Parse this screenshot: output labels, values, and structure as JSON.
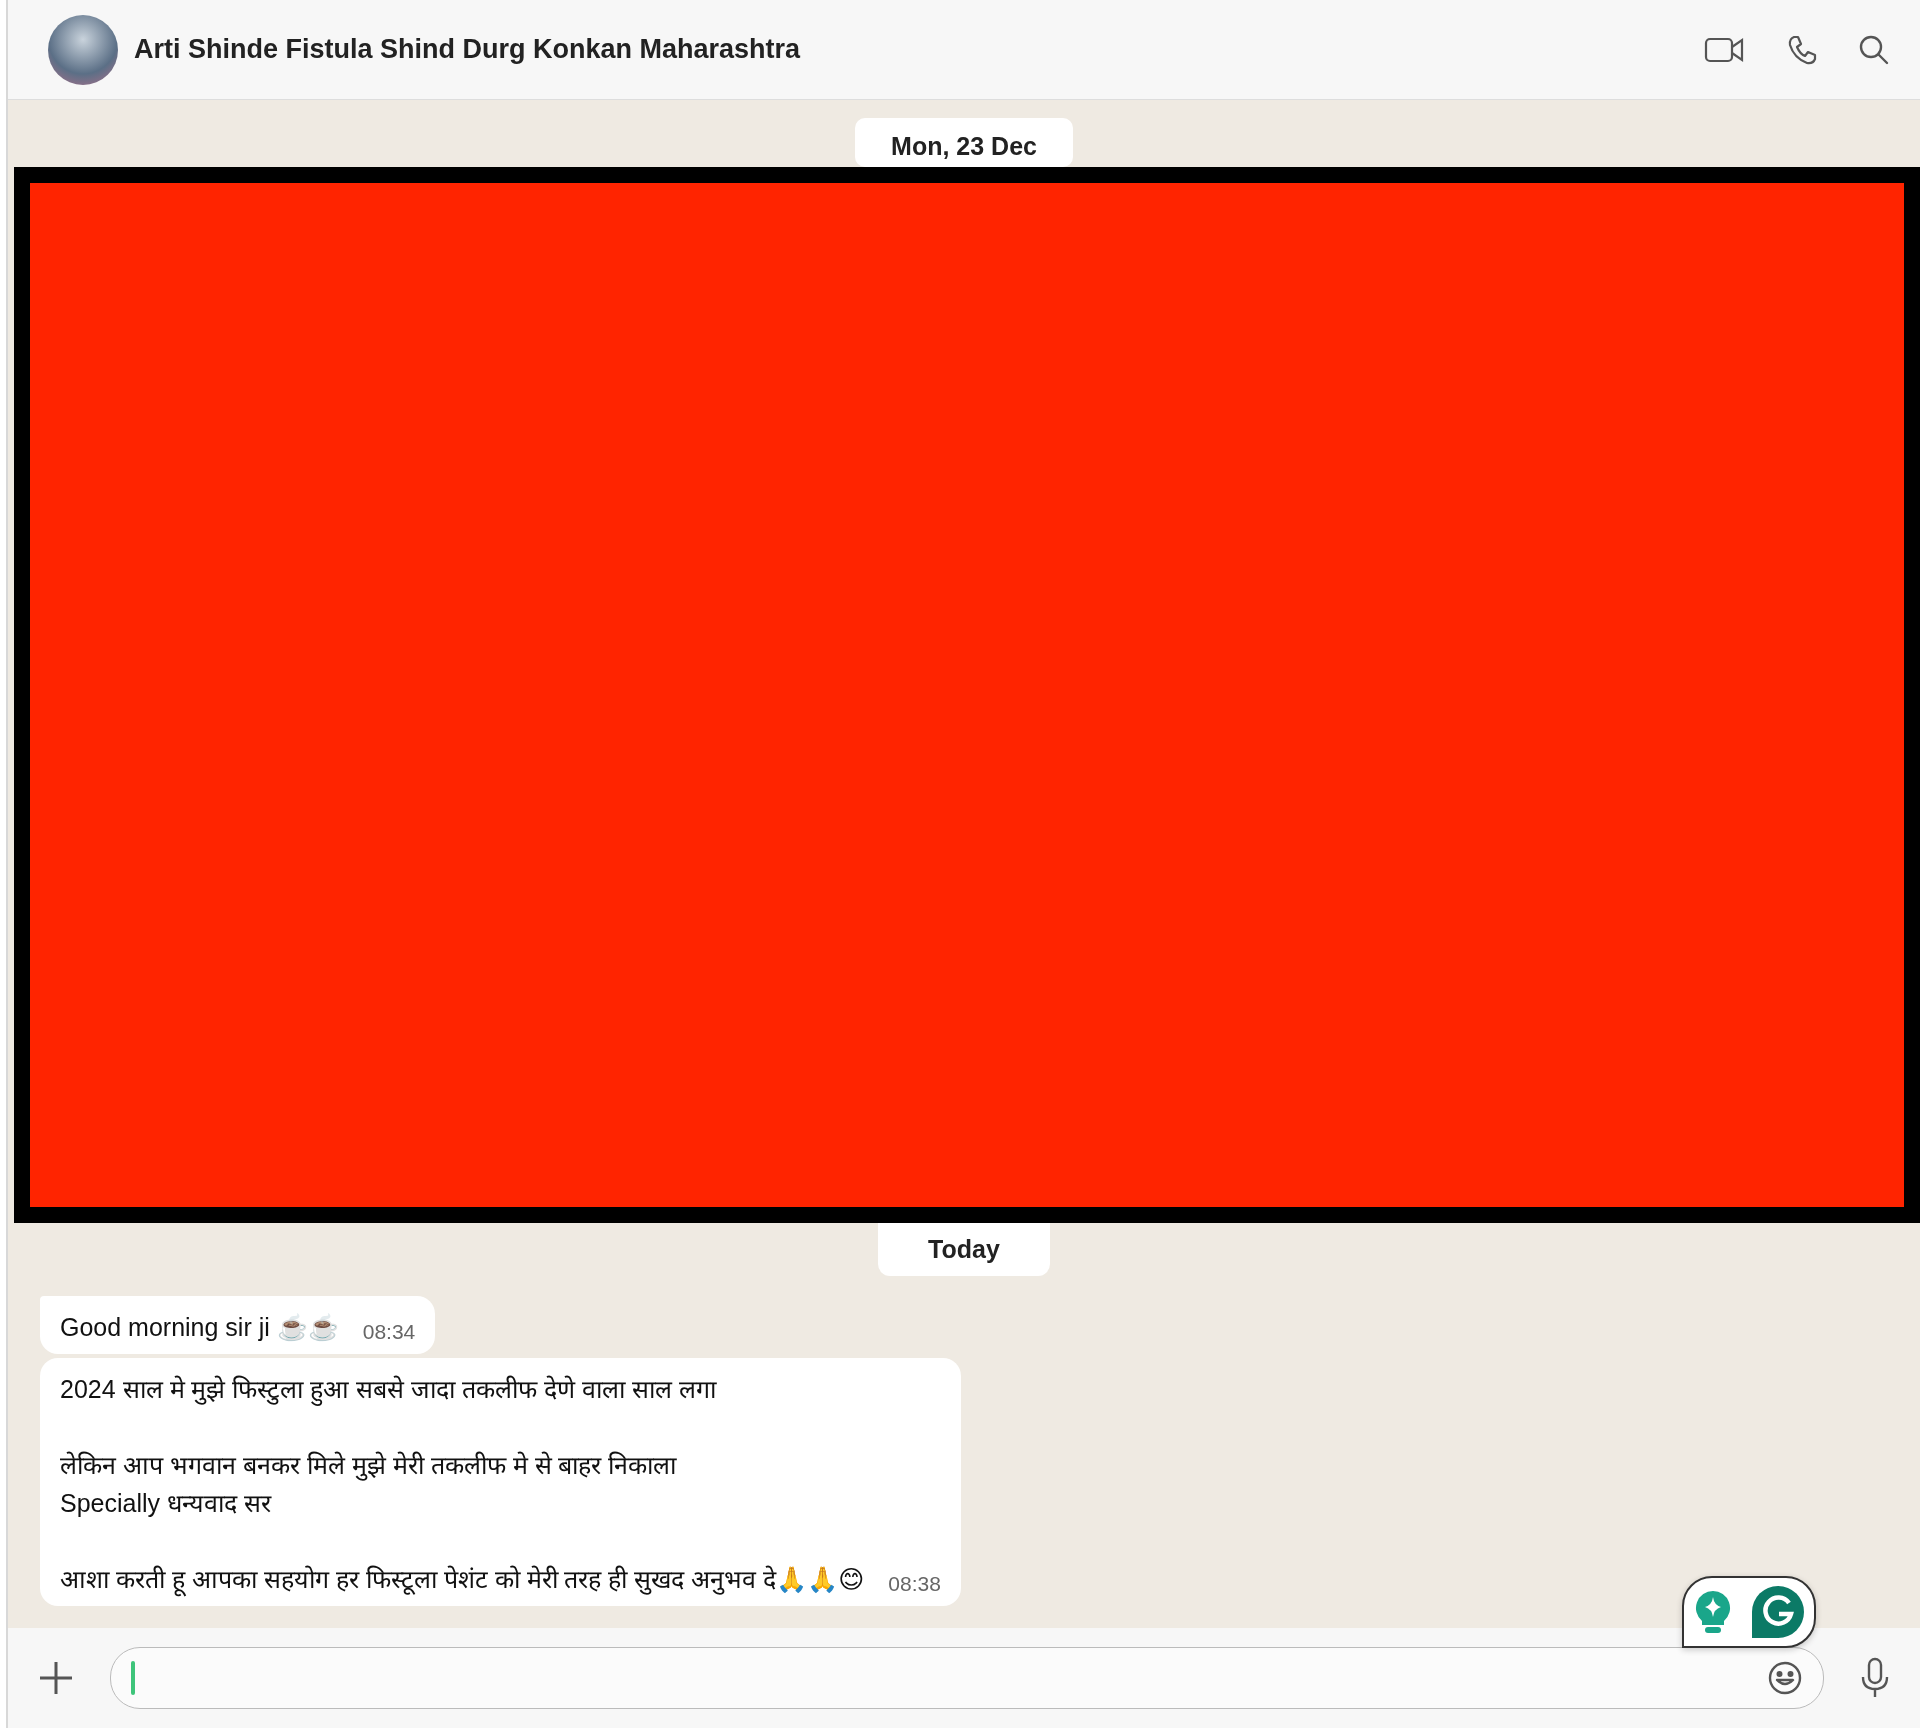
{
  "header": {
    "title": "Arti Shinde Fistula Shind Durg Konkan Maharashtra"
  },
  "messages": [
    {
      "kind": "date",
      "text": "Mon, 23 Dec"
    },
    {
      "kind": "redacted"
    },
    {
      "kind": "date",
      "text": "Today"
    },
    {
      "kind": "incoming",
      "text": "Good morning sir ji ☕️☕️",
      "time": "08:34",
      "tail": true
    },
    {
      "kind": "incoming",
      "text": "2024 साल मे मुझे फिस्टुला हुआ सबसे जादा तकलीफ देणे वाला साल लगा\n\nलेकिन आप भगवान बनकर मिले मुझे मेरी तकलीफ मे से बाहर निकाला\nSpecially धन्यवाद सर\n\nआशा करती हू आपका सहयोग हर फिस्टूला पेशंट को मेरी तरह ही सुखद अनुभव दे🙏🙏😊",
      "time": "08:38",
      "tail": false
    }
  ],
  "composer": {
    "focused": true
  }
}
